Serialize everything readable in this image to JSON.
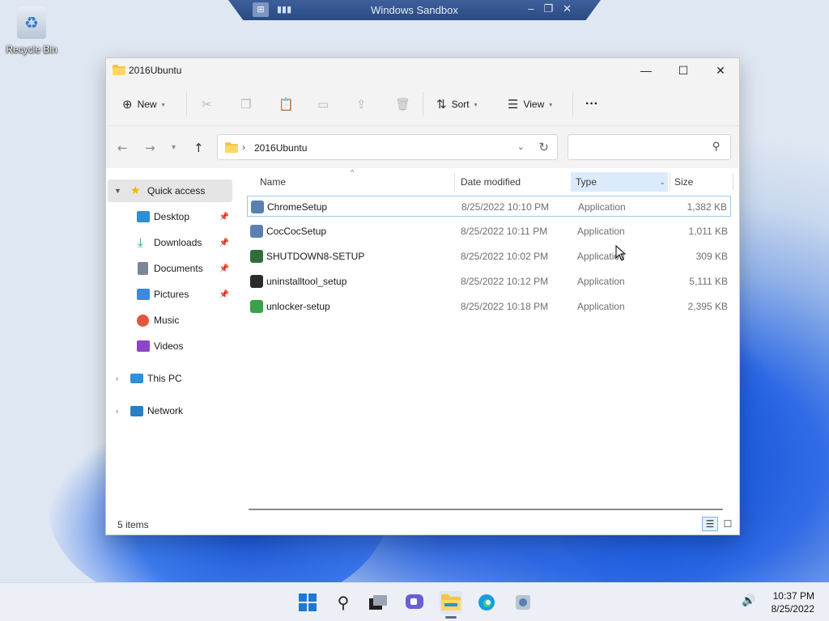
{
  "desktop": {
    "recycle_bin_label": "Recycle Bin"
  },
  "sandbox": {
    "title": "Windows Sandbox"
  },
  "window": {
    "title": "2016Ubuntu",
    "toolbar": {
      "new_label": "New",
      "sort_label": "Sort",
      "view_label": "View",
      "more_label": "···"
    },
    "address": {
      "path": "2016Ubuntu"
    },
    "search": {
      "placeholder": ""
    }
  },
  "sidebar": {
    "quick_access": "Quick access",
    "items": [
      {
        "label": "Desktop",
        "icon": "desktop-icon",
        "color": "#2b8fd9",
        "pinned": true
      },
      {
        "label": "Downloads",
        "icon": "downloads-icon",
        "color": "#1f9d55",
        "pinned": true
      },
      {
        "label": "Documents",
        "icon": "documents-icon",
        "color": "#7a8796",
        "pinned": true
      },
      {
        "label": "Pictures",
        "icon": "pictures-icon",
        "color": "#3a8be0",
        "pinned": true
      },
      {
        "label": "Music",
        "icon": "music-icon",
        "color": "#e2563b",
        "pinned": false
      },
      {
        "label": "Videos",
        "icon": "videos-icon",
        "color": "#8e44c9",
        "pinned": false
      }
    ],
    "this_pc": "This PC",
    "network": "Network"
  },
  "columns": {
    "name": "Name",
    "date": "Date modified",
    "type": "Type",
    "size": "Size"
  },
  "files": [
    {
      "name": "ChromeSetup",
      "date": "8/25/2022 10:10 PM",
      "type": "Application",
      "size": "1,382 KB",
      "color": "#5b7fb0"
    },
    {
      "name": "CocCocSetup",
      "date": "8/25/2022 10:11 PM",
      "type": "Application",
      "size": "1,011 KB",
      "color": "#5b7fb0"
    },
    {
      "name": "SHUTDOWN8-SETUP",
      "date": "8/25/2022 10:02 PM",
      "type": "Application",
      "size": "309 KB",
      "color": "#2f6e3a"
    },
    {
      "name": "uninstalltool_setup",
      "date": "8/25/2022 10:12 PM",
      "type": "Application",
      "size": "5,111 KB",
      "color": "#2a2a2a"
    },
    {
      "name": "unlocker-setup",
      "date": "8/25/2022 10:18 PM",
      "type": "Application",
      "size": "2,395 KB",
      "color": "#3aa04a"
    }
  ],
  "status": {
    "count": "5 items"
  },
  "tray": {
    "time": "10:37 PM",
    "date": "8/25/2022"
  },
  "colors": {
    "accent": "#0067c0",
    "folder": "#f5c542",
    "selection_border": "#99c9ef"
  }
}
